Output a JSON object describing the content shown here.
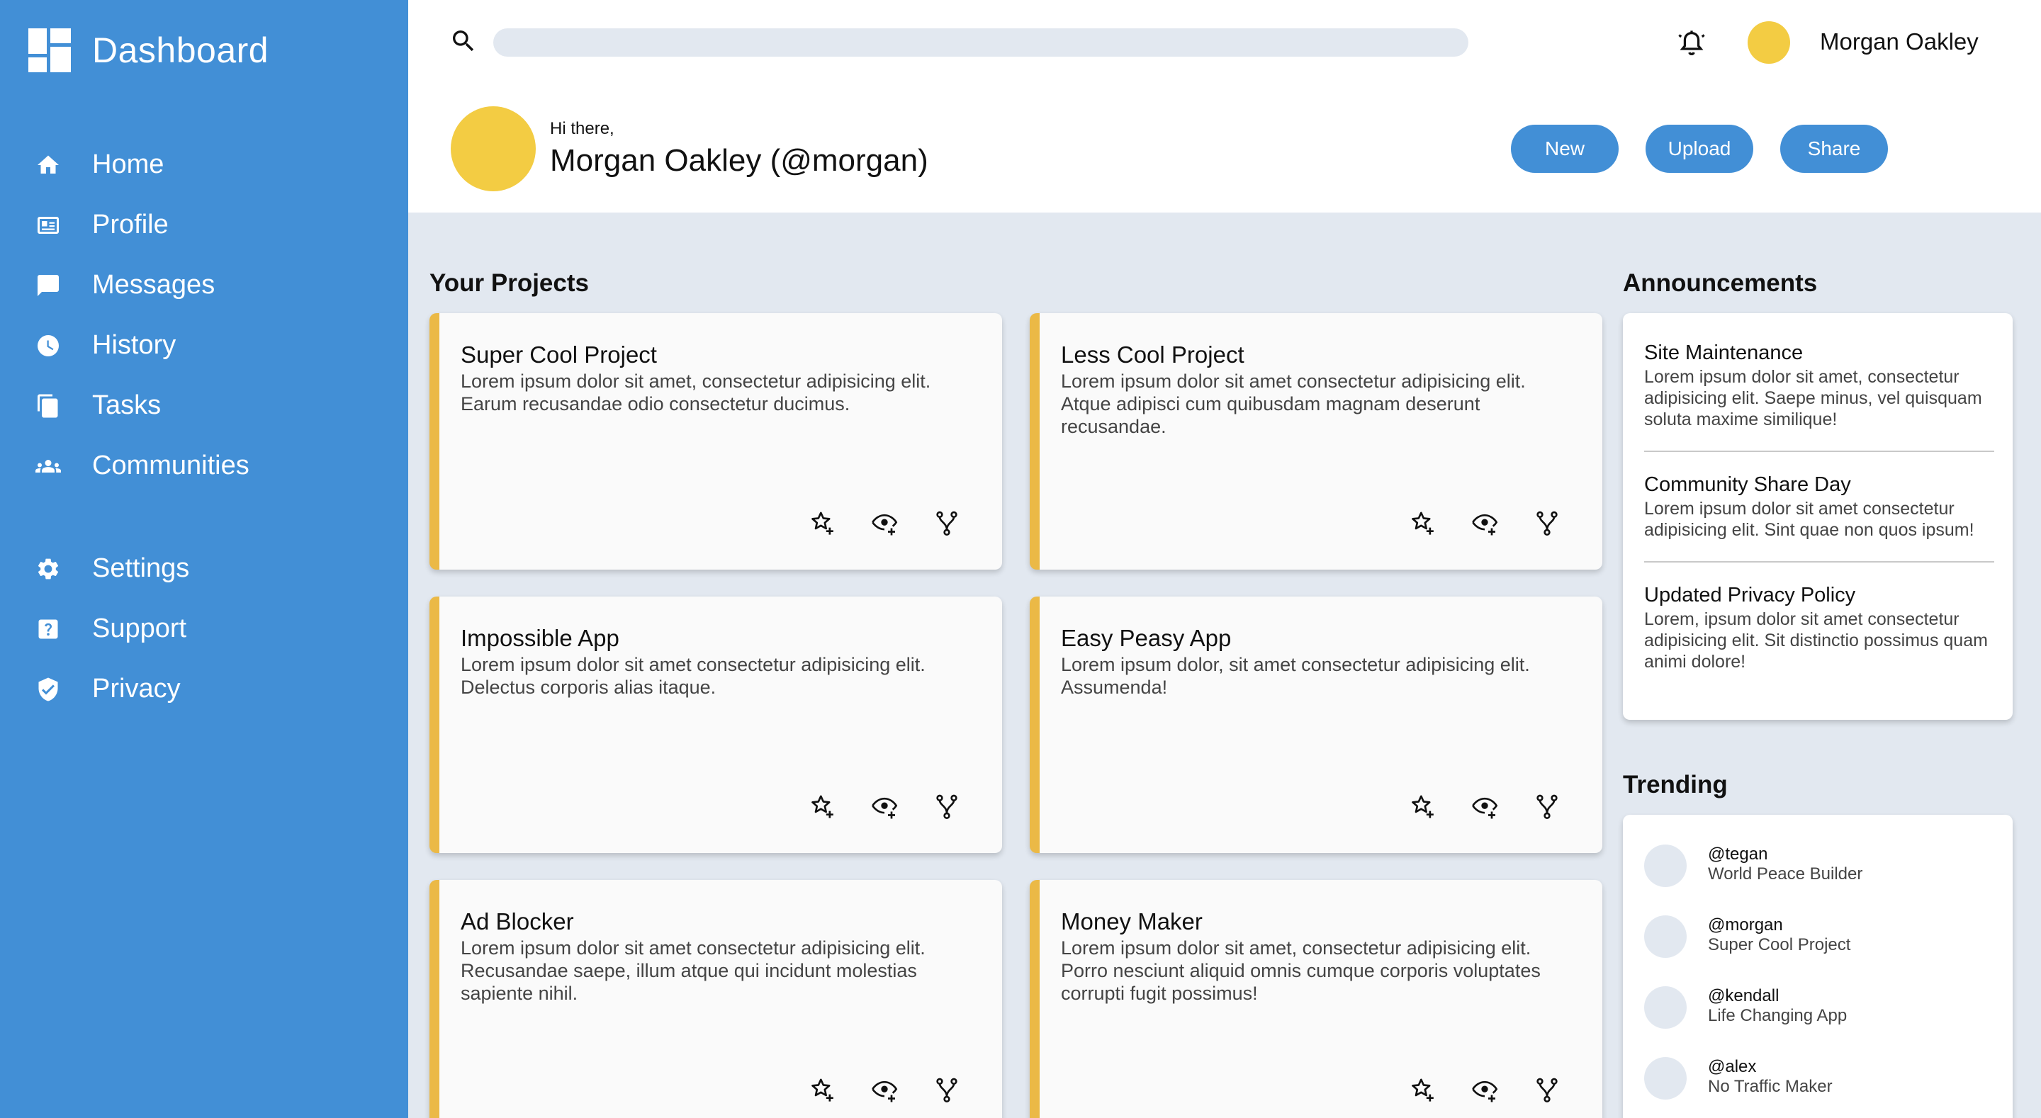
{
  "sidebar": {
    "brand": "Dashboard",
    "nav_main": [
      {
        "label": "Home",
        "icon": "home-icon"
      },
      {
        "label": "Profile",
        "icon": "profile-card-icon"
      },
      {
        "label": "Messages",
        "icon": "message-icon"
      },
      {
        "label": "History",
        "icon": "clock-icon"
      },
      {
        "label": "Tasks",
        "icon": "document-icon"
      },
      {
        "label": "Communities",
        "icon": "group-icon"
      }
    ],
    "nav_secondary": [
      {
        "label": "Settings",
        "icon": "gear-icon"
      },
      {
        "label": "Support",
        "icon": "help-icon"
      },
      {
        "label": "Privacy",
        "icon": "shield-icon"
      }
    ]
  },
  "topbar": {
    "search_placeholder": "",
    "search_value": "",
    "username": "Morgan Oakley"
  },
  "greeting": {
    "hello": "Hi there,",
    "name": "Morgan Oakley (@morgan)",
    "buttons": {
      "new": "New",
      "upload": "Upload",
      "share": "Share"
    }
  },
  "projects": {
    "heading": "Your Projects",
    "items": [
      {
        "title": "Super Cool Project",
        "desc": "Lorem ipsum dolor sit amet, consectetur adipisicing elit. Earum recusandae odio consectetur ducimus."
      },
      {
        "title": "Less Cool Project",
        "desc": "Lorem ipsum dolor sit amet consectetur adipisicing elit. Atque adipisci cum quibusdam magnam deserunt recusandae."
      },
      {
        "title": "Impossible App",
        "desc": "Lorem ipsum dolor sit amet consectetur adipisicing elit. Delectus corporis alias itaque."
      },
      {
        "title": "Easy Peasy App",
        "desc": "Lorem ipsum dolor, sit amet consectetur adipisicing elit. Assumenda!"
      },
      {
        "title": "Ad Blocker",
        "desc": "Lorem ipsum dolor sit amet consectetur adipisicing elit. Recusandae saepe, illum atque qui incidunt molestias sapiente nihil."
      },
      {
        "title": "Money Maker",
        "desc": "Lorem ipsum dolor sit amet, consectetur adipisicing elit. Porro nesciunt aliquid omnis cumque corporis voluptates corrupti fugit possimus!"
      }
    ],
    "card_icons": [
      "star-add-icon",
      "watch-eye-icon",
      "fork-icon"
    ]
  },
  "announcements": {
    "heading": "Announcements",
    "items": [
      {
        "title": "Site Maintenance",
        "body": "Lorem ipsum dolor sit amet, consectetur adipisicing elit. Saepe minus, vel quisquam soluta maxime similique!"
      },
      {
        "title": "Community Share Day",
        "body": "Lorem ipsum dolor sit amet consectetur adipisicing elit. Sint quae non quos ipsum!"
      },
      {
        "title": "Updated Privacy Policy",
        "body": "Lorem, ipsum dolor sit amet consectetur adipisicing elit. Sit distinctio possimus quam animi dolore!"
      }
    ]
  },
  "trending": {
    "heading": "Trending",
    "items": [
      {
        "handle": "@tegan",
        "project": "World Peace Builder"
      },
      {
        "handle": "@morgan",
        "project": "Super Cool Project"
      },
      {
        "handle": "@kendall",
        "project": "Life Changing App"
      },
      {
        "handle": "@alex",
        "project": "No Traffic Maker"
      }
    ]
  },
  "colors": {
    "sidebar": "#428fd6",
    "accent": "#ebb946",
    "avatar": "#f3cc43",
    "background": "#e2e8f0"
  }
}
